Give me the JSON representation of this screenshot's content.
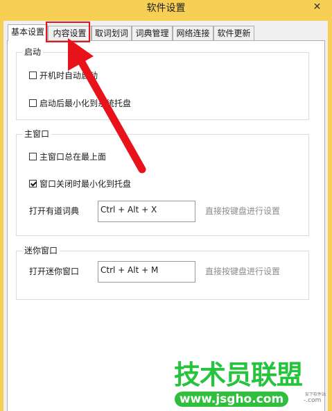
{
  "window": {
    "title": "软件设置",
    "close_label": "✕"
  },
  "tabs": [
    {
      "label": "基本设置",
      "active": true
    },
    {
      "label": "内容设置",
      "active": false
    },
    {
      "label": "取词划词",
      "active": false
    },
    {
      "label": "词典管理",
      "active": false
    },
    {
      "label": "网络连接",
      "active": false
    },
    {
      "label": "软件更新",
      "active": false
    }
  ],
  "groups": {
    "startup": {
      "title": "启动",
      "options": [
        {
          "label": "开机时自动启动",
          "checked": false
        },
        {
          "label": "启动后最小化到系统托盘",
          "checked": false
        }
      ]
    },
    "main_window": {
      "title": "主窗口",
      "options": [
        {
          "label": "主窗口总在最上面",
          "checked": false
        },
        {
          "label": "窗口关闭时最小化到托盘",
          "checked": true
        }
      ],
      "hotkey_label": "打开有道词典",
      "hotkey_value": "Ctrl + Alt + X",
      "hotkey_hint": "直接按键盘进行设置"
    },
    "mini_window": {
      "title": "迷你窗口",
      "hotkey_label": "打开迷你窗口",
      "hotkey_value": "Ctrl + Alt + M",
      "hotkey_hint": "直接按键盘进行设置"
    }
  },
  "annotation": {
    "highlight_color": "#e8121b",
    "arrow_color": "#e8121b"
  },
  "watermark": {
    "name": "技术员联盟",
    "url": "www.jsgho.com",
    "small_1": "安下软件站",
    "small_2": "-.com"
  }
}
